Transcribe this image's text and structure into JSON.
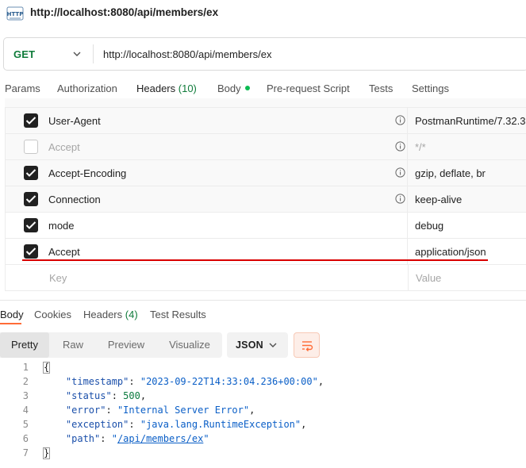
{
  "title": "http://localhost:8080/api/members/ex",
  "request": {
    "method": "GET",
    "url": "http://localhost:8080/api/members/ex"
  },
  "request_tabs": {
    "params": "Params",
    "authorization": "Authorization",
    "headers": "Headers",
    "headers_count": "(10)",
    "body": "Body",
    "pre_request": "Pre-request Script",
    "tests": "Tests",
    "settings": "Settings"
  },
  "headers": [
    {
      "key": "User-Agent",
      "value": "PostmanRuntime/7.32.3",
      "checked": true,
      "info": true,
      "dim": false
    },
    {
      "key": "Accept",
      "value": "*/*",
      "checked": false,
      "info": true,
      "dim": true
    },
    {
      "key": "Accept-Encoding",
      "value": "gzip, deflate, br",
      "checked": true,
      "info": true,
      "dim": false
    },
    {
      "key": "Connection",
      "value": "keep-alive",
      "checked": true,
      "info": true,
      "dim": false
    },
    {
      "key": "mode",
      "value": "debug",
      "checked": true,
      "info": false,
      "dim": false
    },
    {
      "key": "Accept",
      "value": "application/json",
      "checked": true,
      "info": false,
      "dim": false
    }
  ],
  "new_header": {
    "key_placeholder": "Key",
    "value_placeholder": "Value"
  },
  "response_tabs": {
    "body": "Body",
    "cookies": "Cookies",
    "headers": "Headers",
    "headers_count": "(4)",
    "test_results": "Test Results"
  },
  "view_modes": [
    "Pretty",
    "Raw",
    "Preview",
    "Visualize"
  ],
  "format": "JSON",
  "response_json": {
    "timestamp_key": "\"timestamp\"",
    "timestamp_val": "\"2023-09-22T14:33:04.236+00:00\"",
    "status_key": "\"status\"",
    "status_val": "500",
    "error_key": "\"error\"",
    "error_val": "\"Internal Server Error\"",
    "exception_key": "\"exception\"",
    "exception_val": "\"java.lang.RuntimeException\"",
    "path_key": "\"path\"",
    "path_q1": "\"",
    "path_val": "/api/members/ex",
    "path_q2": "\""
  },
  "line_numbers": [
    "1",
    "2",
    "3",
    "4",
    "5",
    "6",
    "7"
  ],
  "colors": {
    "accent": "#ff6c37",
    "method": "#0f7b3a",
    "highlight_line": "#d90000"
  }
}
